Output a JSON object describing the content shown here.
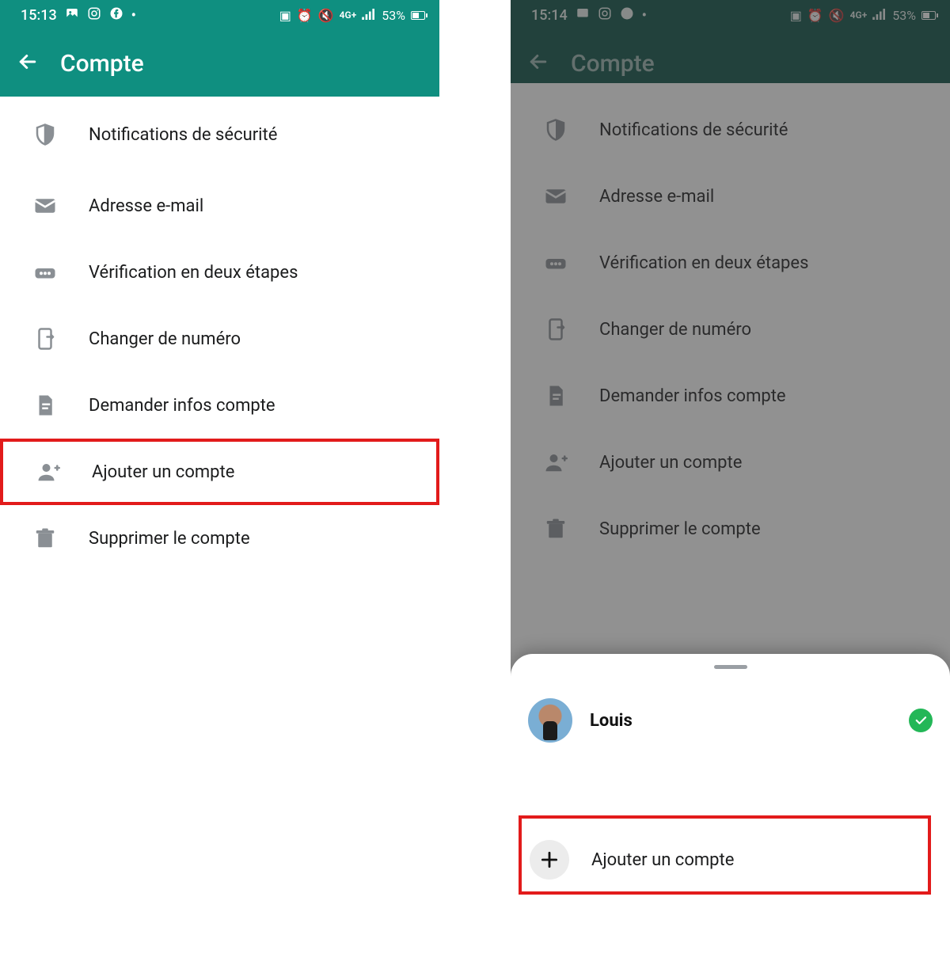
{
  "left": {
    "status": {
      "time": "15:13",
      "battery": "53%",
      "network": "4G+"
    },
    "appbar_title": "Compte",
    "items": [
      {
        "label": "Notifications de sécurité"
      },
      {
        "label": "Adresse e-mail"
      },
      {
        "label": "Vérification en deux étapes"
      },
      {
        "label": "Changer de numéro"
      },
      {
        "label": "Demander infos compte"
      },
      {
        "label": "Ajouter un compte"
      },
      {
        "label": "Supprimer le compte"
      }
    ]
  },
  "right": {
    "status": {
      "time": "15:14",
      "battery": "53%",
      "network": "4G+"
    },
    "appbar_title": "Compte",
    "items": [
      {
        "label": "Notifications de sécurité"
      },
      {
        "label": "Adresse e-mail"
      },
      {
        "label": "Vérification en deux étapes"
      },
      {
        "label": "Changer de numéro"
      },
      {
        "label": "Demander infos compte"
      },
      {
        "label": "Ajouter un compte"
      },
      {
        "label": "Supprimer le compte"
      }
    ],
    "sheet": {
      "account_name": "Louis",
      "add_label": "Ajouter un compte"
    }
  },
  "colors": {
    "brand": "#0f8f80",
    "brand_dark": "#0a4f44",
    "icon_grey": "#8a8f94",
    "highlight": "#e21b1b",
    "check_green": "#23b757"
  }
}
